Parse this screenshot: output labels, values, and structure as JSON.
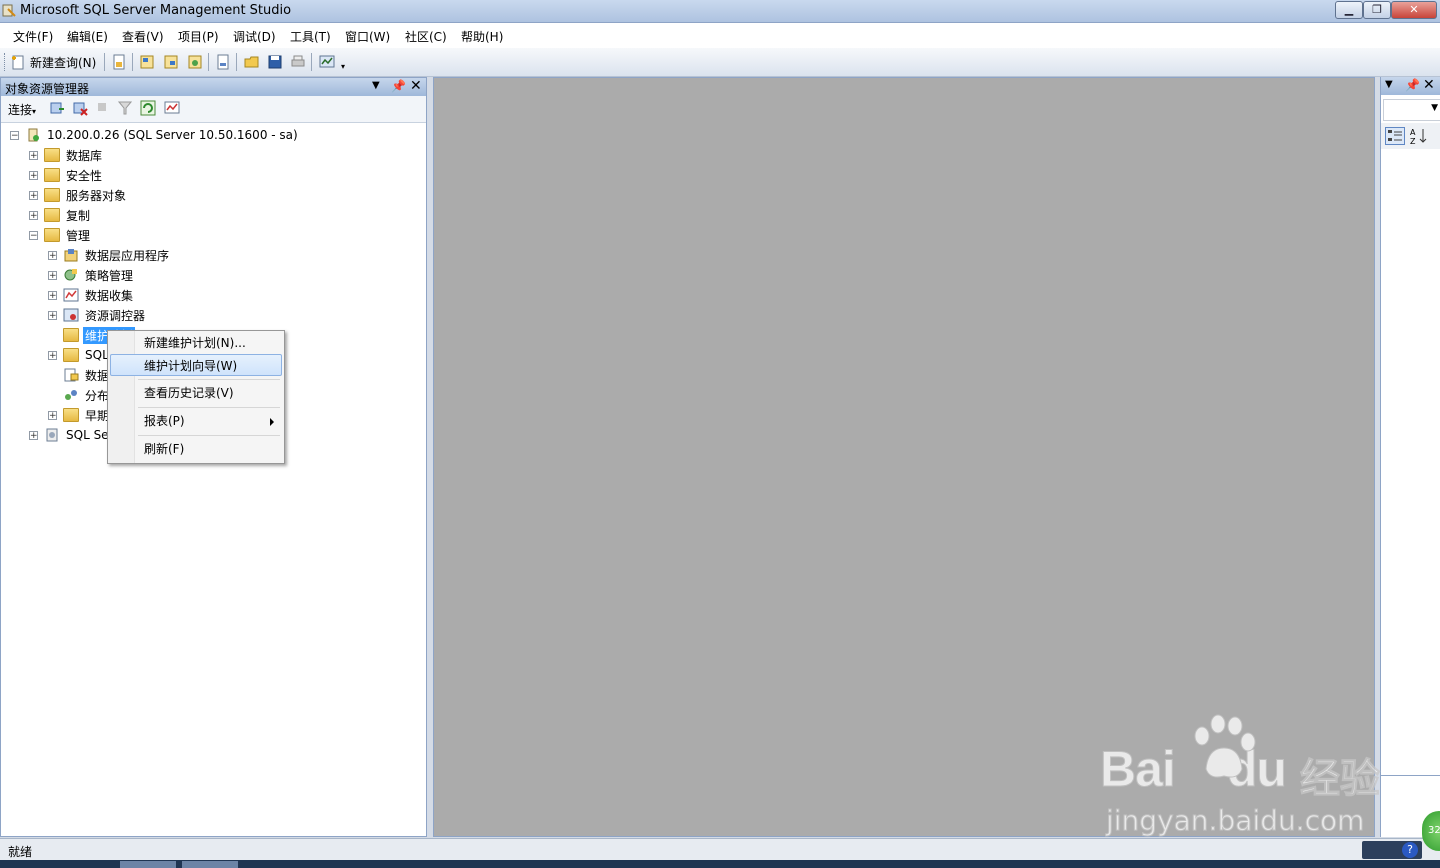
{
  "window": {
    "title": "Microsoft SQL Server Management Studio"
  },
  "menubar": [
    "文件(F)",
    "编辑(E)",
    "查看(V)",
    "项目(P)",
    "调试(D)",
    "工具(T)",
    "窗口(W)",
    "社区(C)",
    "帮助(H)"
  ],
  "toolbar": {
    "new_query_label": "新建查询(N)"
  },
  "object_explorer": {
    "title": "对象资源管理器",
    "connect_label": "连接",
    "tree": [
      {
        "label": "10.200.0.26 (SQL Server 10.50.1600 - sa)",
        "level": 0,
        "expander": "−",
        "icon": "server-icon"
      },
      {
        "label": "数据库",
        "level": 1,
        "expander": "+",
        "icon": "folder-icon"
      },
      {
        "label": "安全性",
        "level": 1,
        "expander": "+",
        "icon": "folder-icon"
      },
      {
        "label": "服务器对象",
        "level": 1,
        "expander": "+",
        "icon": "folder-icon"
      },
      {
        "label": "复制",
        "level": 1,
        "expander": "+",
        "icon": "folder-icon"
      },
      {
        "label": "管理",
        "level": 1,
        "expander": "−",
        "icon": "folder-icon"
      },
      {
        "label": "数据层应用程序",
        "level": 2,
        "expander": "+",
        "icon": "data-tier-app-icon"
      },
      {
        "label": "策略管理",
        "level": 2,
        "expander": "+",
        "icon": "policy-icon"
      },
      {
        "label": "数据收集",
        "level": 2,
        "expander": "+",
        "icon": "data-collection-icon"
      },
      {
        "label": "资源调控器",
        "level": 2,
        "expander": "+",
        "icon": "resource-governor-icon"
      },
      {
        "label": "维护计划",
        "level": 2,
        "expander": "",
        "icon": "folder-icon",
        "selected": true
      },
      {
        "label": "SQL",
        "level": 2,
        "expander": "+",
        "icon": "folder-icon"
      },
      {
        "label": "数据",
        "level": 2,
        "expander": "",
        "icon": "database-mail-icon"
      },
      {
        "label": "分布",
        "level": 2,
        "expander": "",
        "icon": "dtc-icon"
      },
      {
        "label": "早期",
        "level": 2,
        "expander": "+",
        "icon": "folder-icon"
      },
      {
        "label": "SQL Se",
        "level": 1,
        "expander": "+",
        "icon": "agent-icon"
      }
    ]
  },
  "context_menu": {
    "items": [
      {
        "label": "新建维护计划(N)...",
        "highlighted": false,
        "submenu": false
      },
      {
        "label": "维护计划向导(W)",
        "highlighted": true,
        "submenu": false
      },
      {
        "separator": true
      },
      {
        "label": "查看历史记录(V)",
        "highlighted": false,
        "submenu": false
      },
      {
        "separator": true
      },
      {
        "label": "报表(P)",
        "highlighted": false,
        "submenu": true
      },
      {
        "separator": true
      },
      {
        "label": "刷新(F)",
        "highlighted": false,
        "submenu": false
      }
    ]
  },
  "statusbar": {
    "text": "就绪"
  },
  "watermark": {
    "brand": "Bai",
    "brand2": "du",
    "cn": "经验",
    "url": "jingyan.baidu.com"
  },
  "colors": {
    "selection": "#3399ff",
    "doc_area": "#ababab",
    "header": "#9fb8da"
  }
}
